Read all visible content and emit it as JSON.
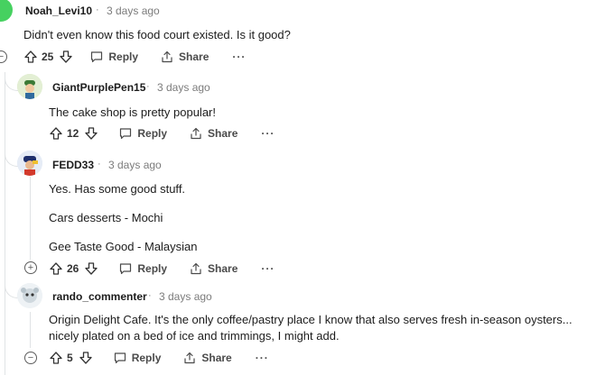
{
  "comments": [
    {
      "author": "Noah_Levi10",
      "time": "3 days ago",
      "lines": [
        "Didn't even know this food court existed. Is it good?"
      ],
      "votes": "25",
      "reply_label": "Reply",
      "share_label": "Share",
      "more": "···"
    },
    {
      "author": "GiantPurplePen15",
      "time": "3 days ago",
      "lines": [
        "The cake shop is pretty popular!"
      ],
      "votes": "12",
      "reply_label": "Reply",
      "share_label": "Share",
      "more": "···"
    },
    {
      "author": "FEDD33",
      "time": "3 days ago",
      "lines": [
        "Yes. Has some good stuff.",
        "Cars desserts - Mochi",
        "Gee Taste Good - Malaysian"
      ],
      "votes": "26",
      "reply_label": "Reply",
      "share_label": "Share",
      "more": "···"
    },
    {
      "author": "rando_commenter",
      "time": "3 days ago",
      "lines": [
        "Origin Delight Cafe. It's the only coffee/pastry place I know that also serves fresh in-season oysters...",
        "nicely plated on a bed of ice and trimmings, I might add."
      ],
      "votes": "5",
      "reply_label": "Reply",
      "share_label": "Share",
      "more": "···"
    }
  ],
  "separator": "·",
  "collapse_symbol": "−",
  "expand_symbol": "+"
}
